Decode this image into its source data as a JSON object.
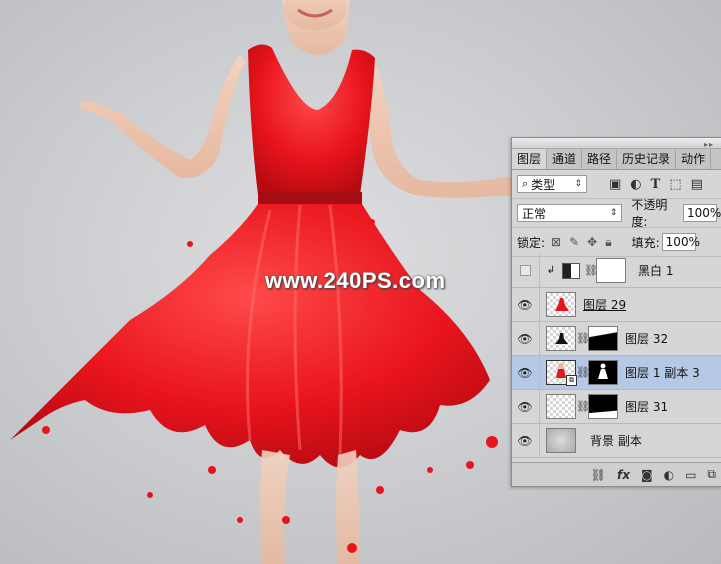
{
  "watermark": "www.240PS.com",
  "panel": {
    "tabs": [
      "图层",
      "通道",
      "路径",
      "历史记录",
      "动作"
    ],
    "filter": {
      "label": "类型",
      "icons": [
        "image-filter-icon",
        "adjustment-filter-icon",
        "type-filter-icon",
        "shape-filter-icon",
        "smart-object-filter-icon"
      ]
    },
    "blend_mode": "正常",
    "opacity_label": "不透明度:",
    "opacity_value": "100%",
    "lock_label": "锁定:",
    "fill_label": "填充:",
    "fill_value": "100%",
    "layers": [
      {
        "name": "黑白 1",
        "visible": false,
        "type": "adjustment"
      },
      {
        "name": "图层 29",
        "visible": true,
        "type": "pixel"
      },
      {
        "name": "图层 32",
        "visible": true,
        "type": "masked"
      },
      {
        "name": "图层 1 副本 3",
        "visible": true,
        "type": "masked",
        "selected": true
      },
      {
        "name": "图层 31",
        "visible": true,
        "type": "masked"
      },
      {
        "name": "背景 副本",
        "visible": true,
        "type": "pixel"
      }
    ]
  },
  "colors": {
    "dress": "#e8141c",
    "selection": "#b5c9e6"
  }
}
